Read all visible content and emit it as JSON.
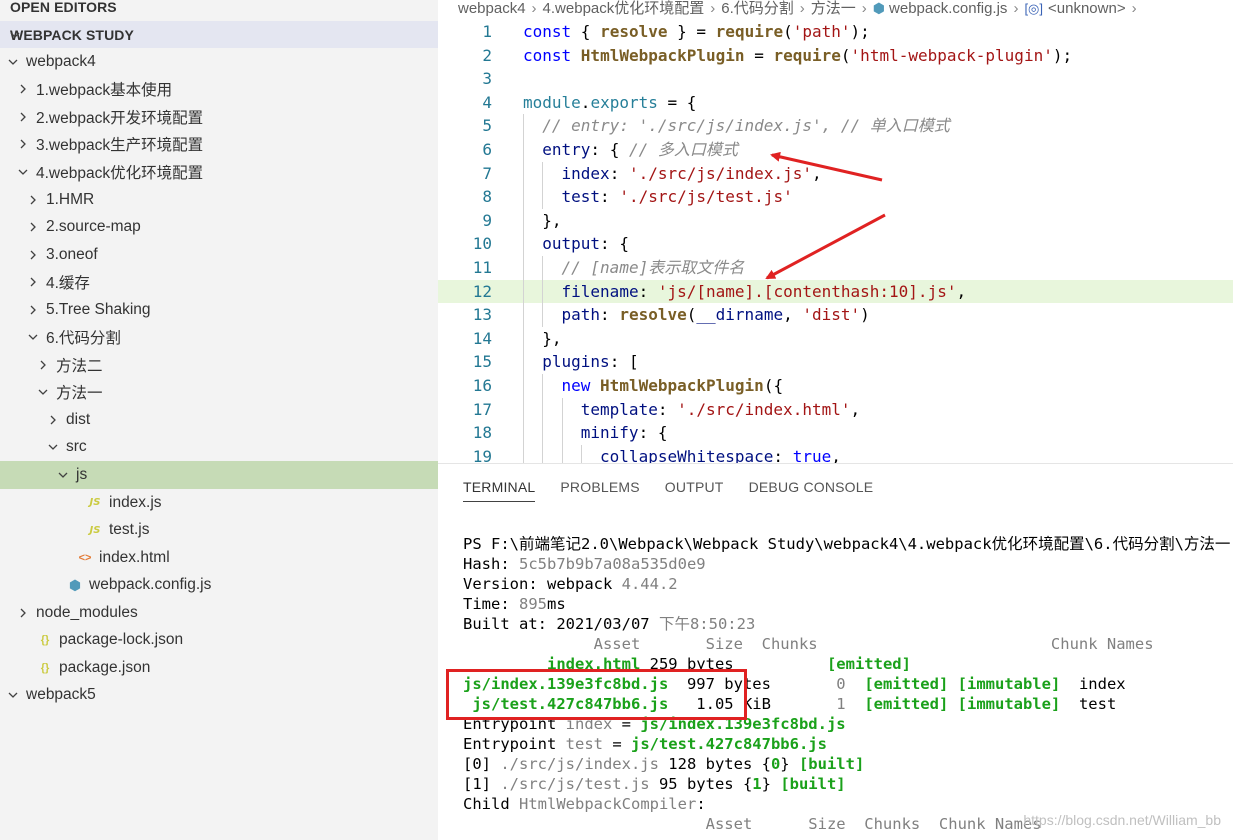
{
  "sidebar": {
    "open_editors": "OPEN EDITORS",
    "workspace": "WEBPACK STUDY",
    "tree": [
      {
        "label": "webpack4",
        "depth": 0,
        "kind": "folder",
        "open": true
      },
      {
        "label": "1.webpack基本使用",
        "depth": 1,
        "kind": "folder",
        "open": false
      },
      {
        "label": "2.webpack开发环境配置",
        "depth": 1,
        "kind": "folder",
        "open": false
      },
      {
        "label": "3.webpack生产环境配置",
        "depth": 1,
        "kind": "folder",
        "open": false
      },
      {
        "label": "4.webpack优化环境配置",
        "depth": 1,
        "kind": "folder",
        "open": true
      },
      {
        "label": "1.HMR",
        "depth": 2,
        "kind": "folder",
        "open": false
      },
      {
        "label": "2.source-map",
        "depth": 2,
        "kind": "folder",
        "open": false
      },
      {
        "label": "3.oneof",
        "depth": 2,
        "kind": "folder",
        "open": false
      },
      {
        "label": "4.缓存",
        "depth": 2,
        "kind": "folder",
        "open": false
      },
      {
        "label": "5.Tree Shaking",
        "depth": 2,
        "kind": "folder",
        "open": false
      },
      {
        "label": "6.代码分割",
        "depth": 2,
        "kind": "folder",
        "open": true
      },
      {
        "label": "方法二",
        "depth": 3,
        "kind": "folder",
        "open": false
      },
      {
        "label": "方法一",
        "depth": 3,
        "kind": "folder",
        "open": true
      },
      {
        "label": "dist",
        "depth": 4,
        "kind": "folder",
        "open": false
      },
      {
        "label": "src",
        "depth": 4,
        "kind": "folder",
        "open": true
      },
      {
        "label": "js",
        "depth": 5,
        "kind": "folder",
        "open": true,
        "selected": true
      },
      {
        "label": "index.js",
        "depth": 6,
        "kind": "js"
      },
      {
        "label": "test.js",
        "depth": 6,
        "kind": "js"
      },
      {
        "label": "index.html",
        "depth": 5,
        "kind": "html"
      },
      {
        "label": "webpack.config.js",
        "depth": 4,
        "kind": "webpack"
      },
      {
        "label": "node_modules",
        "depth": 1,
        "kind": "folder",
        "open": false
      },
      {
        "label": "package-lock.json",
        "depth": 1,
        "kind": "json"
      },
      {
        "label": "package.json",
        "depth": 1,
        "kind": "json"
      },
      {
        "label": "webpack5",
        "depth": 0,
        "kind": "folder",
        "open": true
      }
    ]
  },
  "breadcrumb": {
    "parts": [
      "webpack4",
      "4.webpack优化环境配置",
      "6.代码分割",
      "方法一"
    ],
    "file": "webpack.config.js",
    "symbol_icon": "[◎]",
    "symbol": "<unknown>",
    "more": "›"
  },
  "code": {
    "highlighted_line": 12,
    "lines": [
      {
        "n": "1",
        "indent": 0,
        "tokens": [
          [
            "k",
            "const "
          ],
          [
            "plain",
            "{ "
          ],
          [
            "f",
            "resolve"
          ],
          [
            "plain",
            " } = "
          ],
          [
            "f",
            "require"
          ],
          [
            "plain",
            "("
          ],
          [
            "s",
            "'path'"
          ],
          [
            "plain",
            ");"
          ]
        ]
      },
      {
        "n": "2",
        "indent": 0,
        "tokens": [
          [
            "k",
            "const "
          ],
          [
            "f",
            "HtmlWebpackPlugin"
          ],
          [
            "plain",
            " = "
          ],
          [
            "f",
            "require"
          ],
          [
            "plain",
            "("
          ],
          [
            "s",
            "'html-webpack-plugin'"
          ],
          [
            "plain",
            ");"
          ]
        ]
      },
      {
        "n": "3",
        "indent": 0,
        "tokens": []
      },
      {
        "n": "4",
        "indent": 0,
        "tokens": [
          [
            "pv",
            "module"
          ],
          [
            "plain",
            "."
          ],
          [
            "pv",
            "exports"
          ],
          [
            "plain",
            " = {"
          ]
        ]
      },
      {
        "n": "5",
        "indent": 1,
        "tokens": [
          [
            "c",
            "// entry: './src/js/index.js', // 单入口模式"
          ]
        ]
      },
      {
        "n": "6",
        "indent": 1,
        "tokens": [
          [
            "p",
            "entry"
          ],
          [
            "plain",
            ": { "
          ],
          [
            "c",
            "// 多入口模式"
          ]
        ]
      },
      {
        "n": "7",
        "indent": 2,
        "tokens": [
          [
            "p",
            "index"
          ],
          [
            "plain",
            ": "
          ],
          [
            "s",
            "'./src/js/index.js'"
          ],
          [
            "plain",
            ","
          ]
        ]
      },
      {
        "n": "8",
        "indent": 2,
        "tokens": [
          [
            "p",
            "test"
          ],
          [
            "plain",
            ": "
          ],
          [
            "s",
            "'./src/js/test.js'"
          ]
        ]
      },
      {
        "n": "9",
        "indent": 1,
        "tokens": [
          [
            "plain",
            "},"
          ]
        ]
      },
      {
        "n": "10",
        "indent": 1,
        "tokens": [
          [
            "p",
            "output"
          ],
          [
            "plain",
            ": {"
          ]
        ]
      },
      {
        "n": "11",
        "indent": 2,
        "tokens": [
          [
            "c",
            "// [name]表示取文件名"
          ]
        ]
      },
      {
        "n": "12",
        "indent": 2,
        "tokens": [
          [
            "p",
            "filename"
          ],
          [
            "plain",
            ": "
          ],
          [
            "s",
            "'js/[name].[contenthash:10].js'"
          ],
          [
            "plain",
            ","
          ]
        ]
      },
      {
        "n": "13",
        "indent": 2,
        "tokens": [
          [
            "p",
            "path"
          ],
          [
            "plain",
            ": "
          ],
          [
            "f",
            "resolve"
          ],
          [
            "plain",
            "("
          ],
          [
            "p",
            "__dirname"
          ],
          [
            "plain",
            ", "
          ],
          [
            "s",
            "'dist'"
          ],
          [
            "plain",
            ")"
          ]
        ]
      },
      {
        "n": "14",
        "indent": 1,
        "tokens": [
          [
            "plain",
            "},"
          ]
        ]
      },
      {
        "n": "15",
        "indent": 1,
        "tokens": [
          [
            "p",
            "plugins"
          ],
          [
            "plain",
            ": ["
          ]
        ]
      },
      {
        "n": "16",
        "indent": 2,
        "tokens": [
          [
            "k",
            "new "
          ],
          [
            "f",
            "HtmlWebpackPlugin"
          ],
          [
            "plain",
            "({"
          ]
        ]
      },
      {
        "n": "17",
        "indent": 3,
        "tokens": [
          [
            "p",
            "template"
          ],
          [
            "plain",
            ": "
          ],
          [
            "s",
            "'./src/index.html'"
          ],
          [
            "plain",
            ","
          ]
        ]
      },
      {
        "n": "18",
        "indent": 3,
        "tokens": [
          [
            "p",
            "minify"
          ],
          [
            "plain",
            ": {"
          ]
        ]
      },
      {
        "n": "19",
        "indent": 4,
        "tokens": [
          [
            "p",
            "collapseWhitespace"
          ],
          [
            "plain",
            ": "
          ],
          [
            "k",
            "true"
          ],
          [
            "plain",
            ","
          ]
        ]
      }
    ]
  },
  "panel": {
    "tabs": [
      "TERMINAL",
      "PROBLEMS",
      "OUTPUT",
      "DEBUG CONSOLE"
    ],
    "active_tab": "TERMINAL"
  },
  "terminal": {
    "lines": [
      [
        [
          "",
          "PS F:\\前端笔记2.0\\Webpack\\Webpack Study\\webpack4\\4.webpack优化环境配置\\6.代码分割\\方法一"
        ]
      ],
      [
        [
          "",
          "Hash: "
        ],
        [
          "t-grey",
          "5c5b7b9b7a08a535d0e9"
        ]
      ],
      [
        [
          "",
          "Version: webpack "
        ],
        [
          "t-grey",
          "4.44.2"
        ]
      ],
      [
        [
          "",
          "Time: "
        ],
        [
          "t-grey",
          "895"
        ],
        [
          "",
          "ms"
        ]
      ],
      [
        [
          "",
          "Built at: 2021/03/07 "
        ],
        [
          "t-grey",
          "下午8:50:23"
        ]
      ],
      [
        [
          "t-grey",
          "              Asset       Size  Chunks                         Chunk Names"
        ]
      ],
      [
        [
          "t-green-b",
          "         index.html"
        ],
        [
          "",
          " 259 bytes          "
        ],
        [
          "t-green-b",
          "[emitted]"
        ]
      ],
      [
        [
          "t-green-b",
          "js/index.139e3fc8bd.js"
        ],
        [
          "",
          "  997 bytes       "
        ],
        [
          "t-grey",
          "0"
        ],
        [
          "",
          "  "
        ],
        [
          "t-green-b",
          "[emitted]"
        ],
        [
          "",
          " "
        ],
        [
          "t-green-b",
          "[immutable]"
        ],
        [
          "",
          "  index"
        ]
      ],
      [
        [
          "t-green-b",
          " js/test.427c847bb6.js"
        ],
        [
          "",
          "   1.05 KiB       "
        ],
        [
          "t-grey",
          "1"
        ],
        [
          "",
          "  "
        ],
        [
          "t-green-b",
          "[emitted]"
        ],
        [
          "",
          " "
        ],
        [
          "t-green-b",
          "[immutable]"
        ],
        [
          "",
          "  test"
        ]
      ],
      [
        [
          "",
          "Entrypoint "
        ],
        [
          "t-grey",
          "index"
        ],
        [
          "",
          " = "
        ],
        [
          "t-green-b",
          "js/index.139e3fc8bd.js"
        ]
      ],
      [
        [
          "",
          "Entrypoint "
        ],
        [
          "t-grey",
          "test"
        ],
        [
          "",
          " = "
        ],
        [
          "t-green-b",
          "js/test.427c847bb6.js"
        ]
      ],
      [
        [
          "",
          "[0] "
        ],
        [
          "t-grey",
          "./src/js/index.js"
        ],
        [
          "",
          " 128 bytes {"
        ],
        [
          "t-green-b",
          "0"
        ],
        [
          "",
          "} "
        ],
        [
          "t-green-b",
          "[built]"
        ]
      ],
      [
        [
          "",
          "[1] "
        ],
        [
          "t-grey",
          "./src/js/test.js"
        ],
        [
          "",
          " 95 bytes {"
        ],
        [
          "t-green-b",
          "1"
        ],
        [
          "",
          "} "
        ],
        [
          "t-green-b",
          "[built]"
        ]
      ],
      [
        [
          "",
          "Child "
        ],
        [
          "t-grey",
          "HtmlWebpackCompiler"
        ],
        [
          "",
          ":"
        ]
      ],
      [
        [
          "t-grey",
          "                          Asset      Size  Chunks  Chunk Names"
        ]
      ]
    ]
  },
  "watermark": "https://blog.csdn.net/William_bb"
}
